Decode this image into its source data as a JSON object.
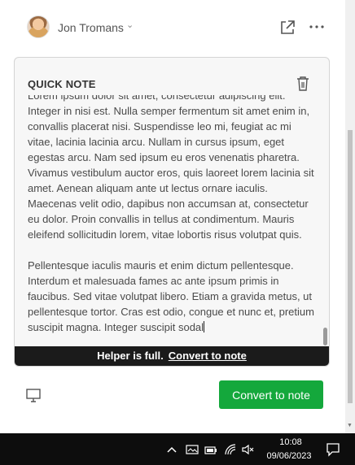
{
  "header": {
    "user_name": "Jon Tromans",
    "dropdown_icon": "chevron-down-icon",
    "open_external_icon": "external-link-icon",
    "more_icon": "more-horizontal-icon"
  },
  "note": {
    "title": "QUICK NOTE",
    "delete_icon": "trash-icon",
    "paragraphs": [
      "Lorem ipsum dolor sit amet, consectetur adipiscing elit. Integer in nisi est. Nulla semper fermentum sit amet enim in, convallis placerat nisi. Suspendisse leo mi, feugiat ac mi vitae, lacinia lacinia arcu. Nullam in cursus ipsum, eget egestas arcu. Nam sed ipsum eu eros venenatis pharetra. Vivamus vestibulum auctor eros, quis laoreet lorem lacinia sit amet. Aenean aliquam ante ut lectus ornare iaculis. Maecenas velit odio, dapibus non accumsan at, consectetur eu dolor. Proin convallis in tellus at condimentum. Mauris eleifend sollicitudin lorem, vitae lobortis risus volutpat quis.",
      "Pellentesque iaculis mauris et enim dictum pellentesque. Interdum et malesuada fames ac ante ipsum primis in faucibus. Sed vitae volutpat libero. Etiam a gravida metus, ut pellentesque tortor. Cras est odio, congue et nunc et, pretium suscipit magna. Integer suscipit sodal"
    ]
  },
  "helper": {
    "message": "Helper is full.",
    "link": "Convert to note"
  },
  "footer": {
    "device_icon": "monitor-icon",
    "convert_button": "Convert to note"
  },
  "colors": {
    "accent_green": "#14a83c",
    "helper_bar": "#1b1b1b",
    "taskbar": "#0d0d0d"
  },
  "taskbar": {
    "icons": [
      "chevron-up-icon",
      "tray-app-icon",
      "battery-icon",
      "wifi-icon",
      "volume-muted-icon"
    ],
    "time": "10:08",
    "date": "09/06/2023",
    "notification_icon": "notification-icon"
  }
}
